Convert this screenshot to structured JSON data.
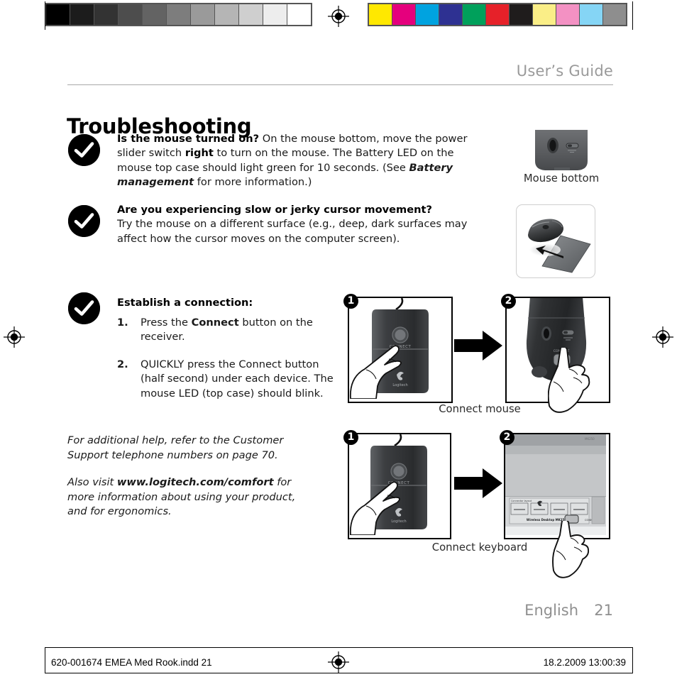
{
  "header": {
    "users_guide": "User’s Guide"
  },
  "page_title": "Troubleshooting",
  "tips": [
    {
      "icon": "checkmark-icon",
      "lead": "Is the mouse turned on?",
      "body_1": " On the mouse bottom, move the power slider switch ",
      "emph_1": "right",
      "body_2": " to turn on the mouse. The Battery LED on the mouse top case should light green for 10 seconds. (See ",
      "emph_2": "Battery management",
      "body_3": " for more information.)"
    },
    {
      "icon": "checkmark-icon",
      "lead": "Are you experiencing slow or jerky cursor movement?",
      "body_1": "Try the mouse on a different surface (e.g., deep, dark surfaces may affect how the cursor moves on the computer screen)."
    }
  ],
  "connection": {
    "icon": "checkmark-icon",
    "heading": "Establish a connection:",
    "steps": [
      {
        "num": "1.",
        "pre": "Press the ",
        "emph": "Connect",
        "post": " button on the receiver."
      },
      {
        "num": "2.",
        "emph": "QUICKLY",
        "post": " press the Connect button (half second) under each device. The mouse LED (top case) should blink."
      }
    ]
  },
  "notes": {
    "note_1": "For additional help, refer to the Customer Support telephone numbers on page 70.",
    "note_2_pre": "Also visit ",
    "note_2_link": "www.logitech.com/comfort",
    "note_2_post": " for more information about using your product, and for ergonomics."
  },
  "figures": {
    "mouse_bottom_caption": "Mouse bottom",
    "connect_mouse_caption": "Connect mouse",
    "connect_keyboard_caption": "Connect keyboard",
    "badge_1": "1",
    "badge_2": "2",
    "receiver_button_label": "CONNECT",
    "receiver_brand": "Logitech",
    "keyboard_brand_line": "Wireless Desktop MK250",
    "keyboard_connect_label": "CONNECT",
    "keyboard_section_label": "Connector layout"
  },
  "footer": {
    "language": "English",
    "page_number": "21",
    "file_line": "620-001674 EMEA Med Rook.indd   21",
    "timestamp": "18.2.2009   13:00:39"
  },
  "calibration": {
    "gray_swatches": [
      "#000000",
      "#1c1c1c",
      "#333333",
      "#4d4d4d",
      "#636363",
      "#7d7d7d",
      "#9a9a9a",
      "#b5b5b5",
      "#cfcfcf",
      "#ededed",
      "#ffffff"
    ],
    "color_swatches": [
      "#ffe800",
      "#e5007d",
      "#00a3e0",
      "#2e3192",
      "#00a05b",
      "#e62129",
      "#1f1c1c",
      "#faee87",
      "#f391c3",
      "#85d5f5",
      "#8e8e8e"
    ],
    "strip_bg": "#555555"
  },
  "colors": {
    "text": "#1a1a1a",
    "muted": "#8f8f8f",
    "rule": "#a8a8a8",
    "badge_bg": "#000000"
  },
  "icons": {
    "registration_mark": "registration-target-icon",
    "check": "checkmark-icon",
    "arrow": "arrow-right-icon"
  }
}
